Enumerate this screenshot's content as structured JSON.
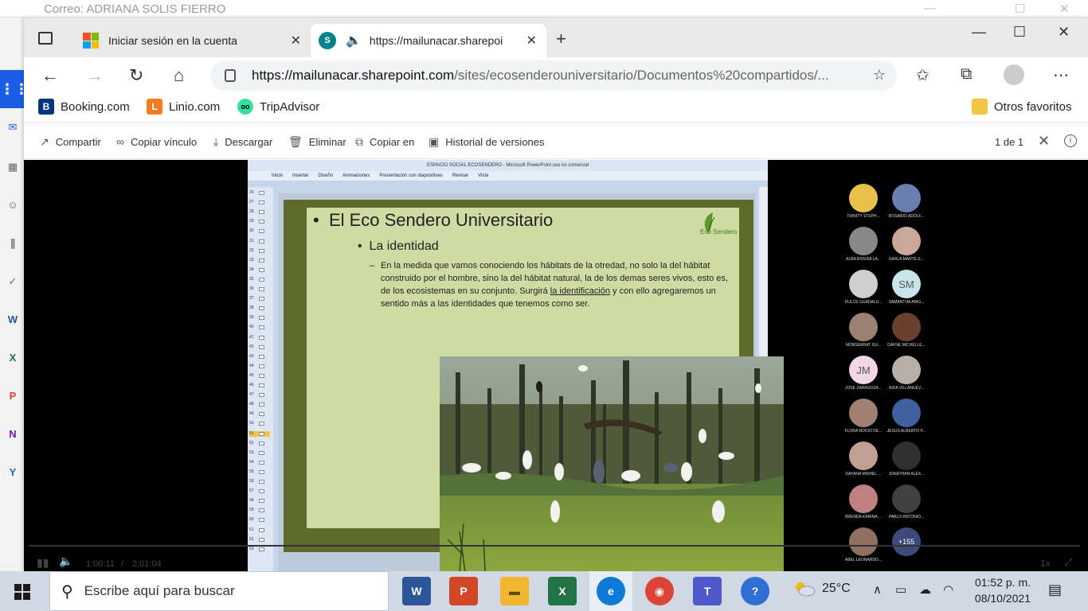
{
  "background_window": {
    "title": "Correo: ADRIANA SOLIS FIERRO"
  },
  "tabs": [
    {
      "label": "Iniciar sesión en la cuenta"
    },
    {
      "label": "https://mailunacar.sharepoi"
    }
  ],
  "address": {
    "url_host": "https://mailunacar.sharepoint.com",
    "url_path": "/sites/ecosenderouniversitario/Documentos%20compartidos/..."
  },
  "favorites": {
    "items": [
      {
        "label": "Booking.com",
        "icon_text": "B",
        "color": "#003580"
      },
      {
        "label": "Linio.com",
        "icon_text": "L",
        "color": "#f47c20"
      },
      {
        "label": "TripAdvisor",
        "icon_text": "oo",
        "color": "#34e0a1"
      }
    ],
    "other": "Otros favoritos"
  },
  "commands": {
    "share": "Compartir",
    "copy_link": "Copiar vínculo",
    "download": "Descargar",
    "delete": "Eliminar",
    "copy_to": "Copiar en",
    "history": "Historial de versiones",
    "pager": "1 de 1"
  },
  "player": {
    "current_time": "1:00:11",
    "separator": "/",
    "total_time": "2:01:04",
    "speed": "1x"
  },
  "ppt": {
    "window_title": "ESPACIO SOCIAL ECOSENDERO - Microsoft PowerPoint uso no comercial",
    "menu": [
      "Inicio",
      "Insertar",
      "Diseño",
      "Animaciones",
      "Presentación con diapositivas",
      "Revisar",
      "Vista"
    ],
    "thumbnails": [
      "26",
      "27",
      "28",
      "29",
      "30",
      "31",
      "32",
      "33",
      "34",
      "35",
      "36",
      "37",
      "38",
      "39",
      "40",
      "41",
      "42",
      "43",
      "44",
      "45",
      "46",
      "47",
      "48",
      "49",
      "50",
      "51",
      "52",
      "53",
      "54",
      "55",
      "56",
      "57",
      "58",
      "59",
      "60",
      "61",
      "62",
      "63"
    ],
    "slide": {
      "bullet1": "El Eco Sendero Universitario",
      "bullet2": "La identidad",
      "body_pre": "En la medida que vamos conociendo los hábitats de la otredad, no solo la del hábitat construido por el hombre,  sino la del hábitat natural, la de los demas seres vivos, esto es, de los ecosistemas en su conjunto. Surgirá ",
      "body_underline": "la identificación",
      "body_post": " y con ello agregaremos un sentido más a las identidades que tenemos como ser.",
      "logo_text": "Eco Sendero"
    }
  },
  "participants": [
    {
      "name": "TRINITY STEPH...",
      "initials": "",
      "color": "#e9c14a"
    },
    {
      "name": "ROSARIO ADOLF...",
      "initials": "",
      "color": "#6a7fb0"
    },
    {
      "name": "ALBA RIVERA LA...",
      "initials": "",
      "color": "#888888"
    },
    {
      "name": "KARLA MARTE E...",
      "initials": "",
      "color": "#c9a89a"
    },
    {
      "name": "DULCE GUADALU...",
      "initials": "",
      "color": "#cfcfcf"
    },
    {
      "name": "SAMANTHA ABIG...",
      "initials": "SM",
      "color": "#c8e6ea"
    },
    {
      "name": "MONSERRAT GU...",
      "initials": "",
      "color": "#9a8070"
    },
    {
      "name": "DAFNE MICHELLE...",
      "initials": "",
      "color": "#6a4030"
    },
    {
      "name": "JOSE ZARAGOZA...",
      "initials": "JM",
      "color": "#f3d6e3"
    },
    {
      "name": "AIDA VILLANUEV...",
      "initials": "",
      "color": "#b8b0a8"
    },
    {
      "name": "FLORA ROCIO DE...",
      "initials": "",
      "color": "#a08070"
    },
    {
      "name": "JESUS ALBERTO P...",
      "initials": "",
      "color": "#4060a0"
    },
    {
      "name": "DAYANA MISHEL ...",
      "initials": "",
      "color": "#c0a090"
    },
    {
      "name": "JONATHAN ALEX...",
      "initials": "",
      "color": "#303030"
    },
    {
      "name": "BRENDA KARINA ...",
      "initials": "",
      "color": "#c08080"
    },
    {
      "name": "PABLO ANTONIO...",
      "initials": "",
      "color": "#404040"
    },
    {
      "name": "ABEL LEONARDO...",
      "initials": "",
      "color": "#907060"
    },
    {
      "name": "",
      "initials": "+155",
      "color": "#3e4a7a"
    }
  ],
  "taskbar": {
    "search_placeholder": "Escribe aquí para buscar",
    "weather": "25°C",
    "time": "01:52 p. m.",
    "date": "08/10/2021"
  }
}
